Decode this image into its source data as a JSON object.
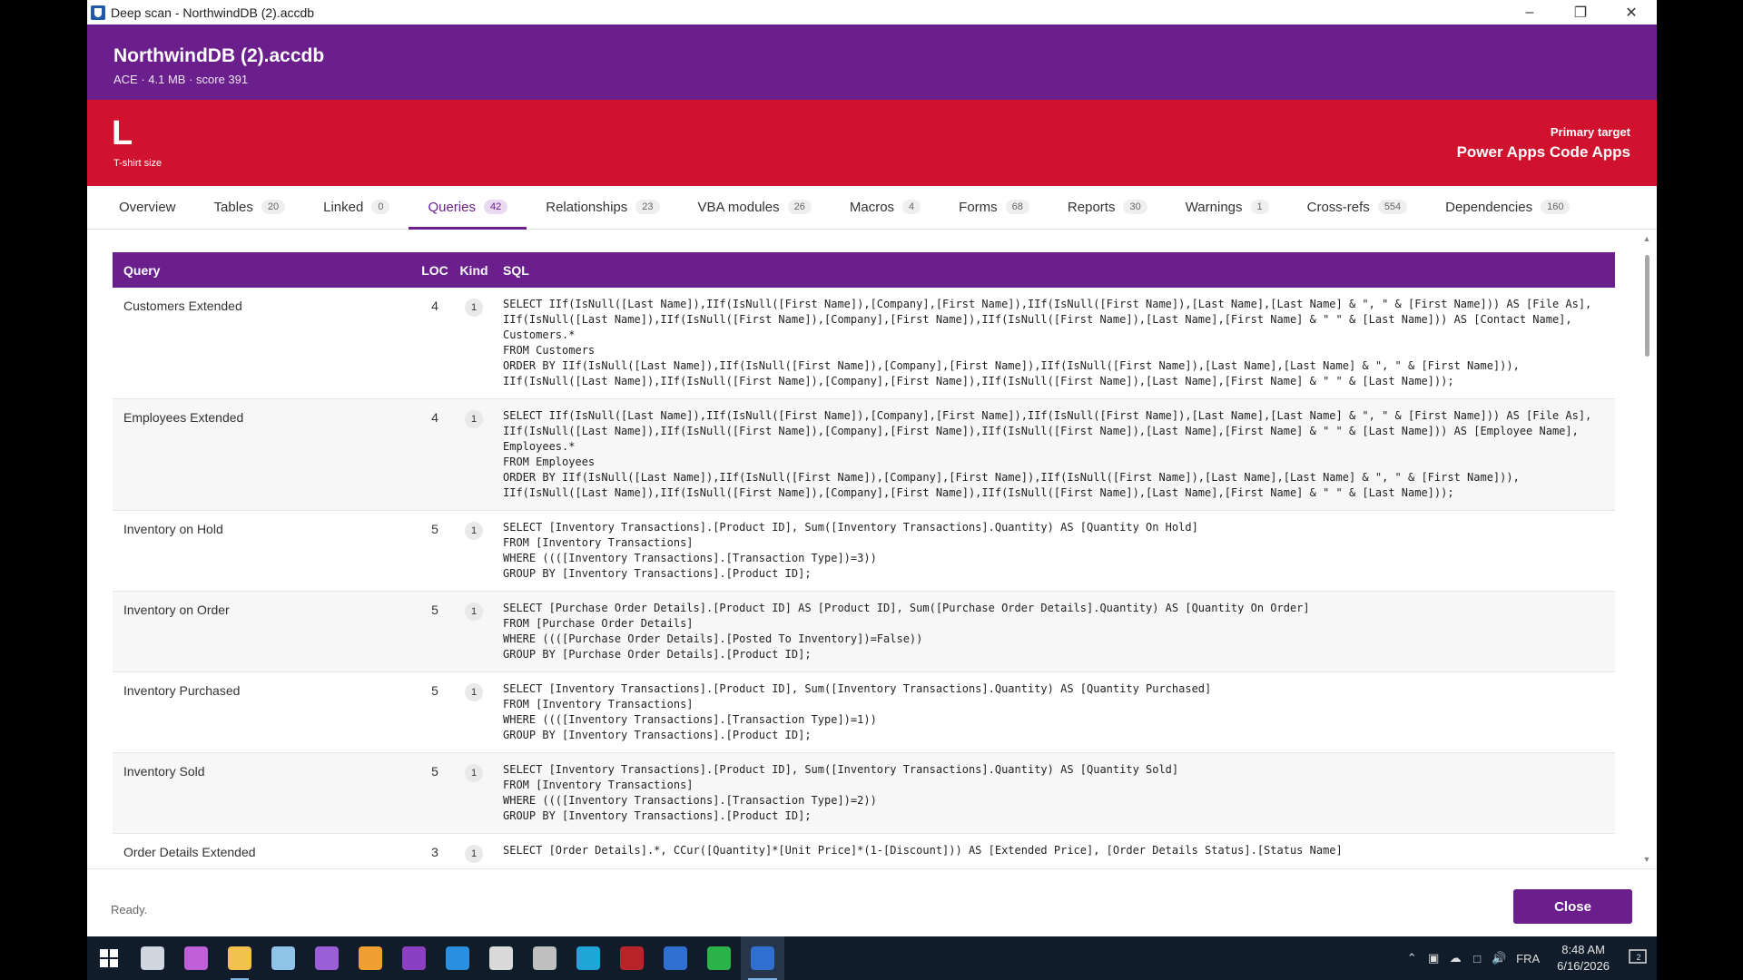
{
  "window": {
    "title": "Deep scan - NorthwindDB (2).accdb"
  },
  "header": {
    "db_name": "NorthwindDB (2).accdb",
    "db_meta": "ACE · 4.1 MB · score 391"
  },
  "size_band": {
    "size_letter": "L",
    "size_label": "T-shirt size",
    "target_label": "Primary target",
    "target_value": "Power Apps Code Apps",
    "color": "#d0122e"
  },
  "tabs": [
    {
      "label": "Overview",
      "count": ""
    },
    {
      "label": "Tables",
      "count": "20"
    },
    {
      "label": "Linked",
      "count": "0"
    },
    {
      "label": "Queries",
      "count": "42",
      "active": true
    },
    {
      "label": "Relationships",
      "count": "23"
    },
    {
      "label": "VBA modules",
      "count": "26"
    },
    {
      "label": "Macros",
      "count": "4"
    },
    {
      "label": "Forms",
      "count": "68"
    },
    {
      "label": "Reports",
      "count": "30"
    },
    {
      "label": "Warnings",
      "count": "1"
    },
    {
      "label": "Cross-refs",
      "count": "554"
    },
    {
      "label": "Dependencies",
      "count": "160"
    }
  ],
  "grid": {
    "columns": {
      "query": "Query",
      "loc": "LOC",
      "kind": "Kind",
      "sql": "SQL"
    },
    "rows": [
      {
        "query": "Customers Extended",
        "loc": "4",
        "kind": "1",
        "sql": "SELECT IIf(IsNull([Last Name]),IIf(IsNull([First Name]),[Company],[First Name]),IIf(IsNull([First Name]),[Last Name],[Last Name] & \", \" & [First Name])) AS [File As], IIf(IsNull([Last Name]),IIf(IsNull([First Name]),[Company],[First Name]),IIf(IsNull([First Name]),[Last Name],[First Name] & \" \" & [Last Name])) AS [Contact Name], Customers.*\nFROM Customers\nORDER BY IIf(IsNull([Last Name]),IIf(IsNull([First Name]),[Company],[First Name]),IIf(IsNull([First Name]),[Last Name],[Last Name] & \", \" & [First Name])), IIf(IsNull([Last Name]),IIf(IsNull([First Name]),[Company],[First Name]),IIf(IsNull([First Name]),[Last Name],[First Name] & \" \" & [Last Name]));"
      },
      {
        "query": "Employees Extended",
        "loc": "4",
        "kind": "1",
        "sql": "SELECT IIf(IsNull([Last Name]),IIf(IsNull([First Name]),[Company],[First Name]),IIf(IsNull([First Name]),[Last Name],[Last Name] & \", \" & [First Name])) AS [File As], IIf(IsNull([Last Name]),IIf(IsNull([First Name]),[Company],[First Name]),IIf(IsNull([First Name]),[Last Name],[First Name] & \" \" & [Last Name])) AS [Employee Name], Employees.*\nFROM Employees\nORDER BY IIf(IsNull([Last Name]),IIf(IsNull([First Name]),[Company],[First Name]),IIf(IsNull([First Name]),[Last Name],[Last Name] & \", \" & [First Name])), IIf(IsNull([Last Name]),IIf(IsNull([First Name]),[Company],[First Name]),IIf(IsNull([First Name]),[Last Name],[First Name] & \" \" & [Last Name]));"
      },
      {
        "query": "Inventory on Hold",
        "loc": "5",
        "kind": "1",
        "sql": "SELECT [Inventory Transactions].[Product ID], Sum([Inventory Transactions].Quantity) AS [Quantity On Hold]\nFROM [Inventory Transactions]\nWHERE ((([Inventory Transactions].[Transaction Type])=3))\nGROUP BY [Inventory Transactions].[Product ID];"
      },
      {
        "query": "Inventory on Order",
        "loc": "5",
        "kind": "1",
        "sql": "SELECT [Purchase Order Details].[Product ID] AS [Product ID], Sum([Purchase Order Details].Quantity) AS [Quantity On Order]\nFROM [Purchase Order Details]\nWHERE ((([Purchase Order Details].[Posted To Inventory])=False))\nGROUP BY [Purchase Order Details].[Product ID];"
      },
      {
        "query": "Inventory Purchased",
        "loc": "5",
        "kind": "1",
        "sql": "SELECT [Inventory Transactions].[Product ID], Sum([Inventory Transactions].Quantity) AS [Quantity Purchased]\nFROM [Inventory Transactions]\nWHERE ((([Inventory Transactions].[Transaction Type])=1))\nGROUP BY [Inventory Transactions].[Product ID];"
      },
      {
        "query": "Inventory Sold",
        "loc": "5",
        "kind": "1",
        "sql": "SELECT [Inventory Transactions].[Product ID], Sum([Inventory Transactions].Quantity) AS [Quantity Sold]\nFROM [Inventory Transactions]\nWHERE ((([Inventory Transactions].[Transaction Type])=2))\nGROUP BY [Inventory Transactions].[Product ID];"
      },
      {
        "query": "Order Details Extended",
        "loc": "3",
        "kind": "1",
        "sql": "SELECT [Order Details].*, CCur([Quantity]*[Unit Price]*(1-[Discount])) AS [Extended Price], [Order Details Status].[Status Name]"
      }
    ]
  },
  "footer": {
    "status": "Ready.",
    "close_label": "Close"
  },
  "taskbar": {
    "apps": [
      {
        "name": "task-view-icon",
        "color": "#cfd6df"
      },
      {
        "name": "copilot-icon",
        "color": "#c05fd8"
      },
      {
        "name": "file-explorer-icon",
        "color": "#f2c14e"
      },
      {
        "name": "notepad-icon",
        "color": "#8ec5e8"
      },
      {
        "name": "visual-studio-icon",
        "color": "#9a5ed6"
      },
      {
        "name": "app-icon-orange",
        "color": "#f0a030"
      },
      {
        "name": "onenote-icon",
        "color": "#8b3fc1"
      },
      {
        "name": "vscode-icon",
        "color": "#2a8fde"
      },
      {
        "name": "paint-icon",
        "color": "#d9d9d9"
      },
      {
        "name": "database-icon",
        "color": "#bfbfbf"
      },
      {
        "name": "edge-icon",
        "color": "#1fa5d8"
      },
      {
        "name": "access-icon",
        "color": "#b8242a"
      },
      {
        "name": "shield-app-icon",
        "color": "#2f6fcf"
      },
      {
        "name": "xbox-icon",
        "color": "#2bb34a"
      },
      {
        "name": "deep-scan-app-icon",
        "color": "#2f6fcf"
      }
    ],
    "language": "FRA",
    "time": "8:48 AM",
    "date": "6/16/2026",
    "notification_count": "2"
  }
}
